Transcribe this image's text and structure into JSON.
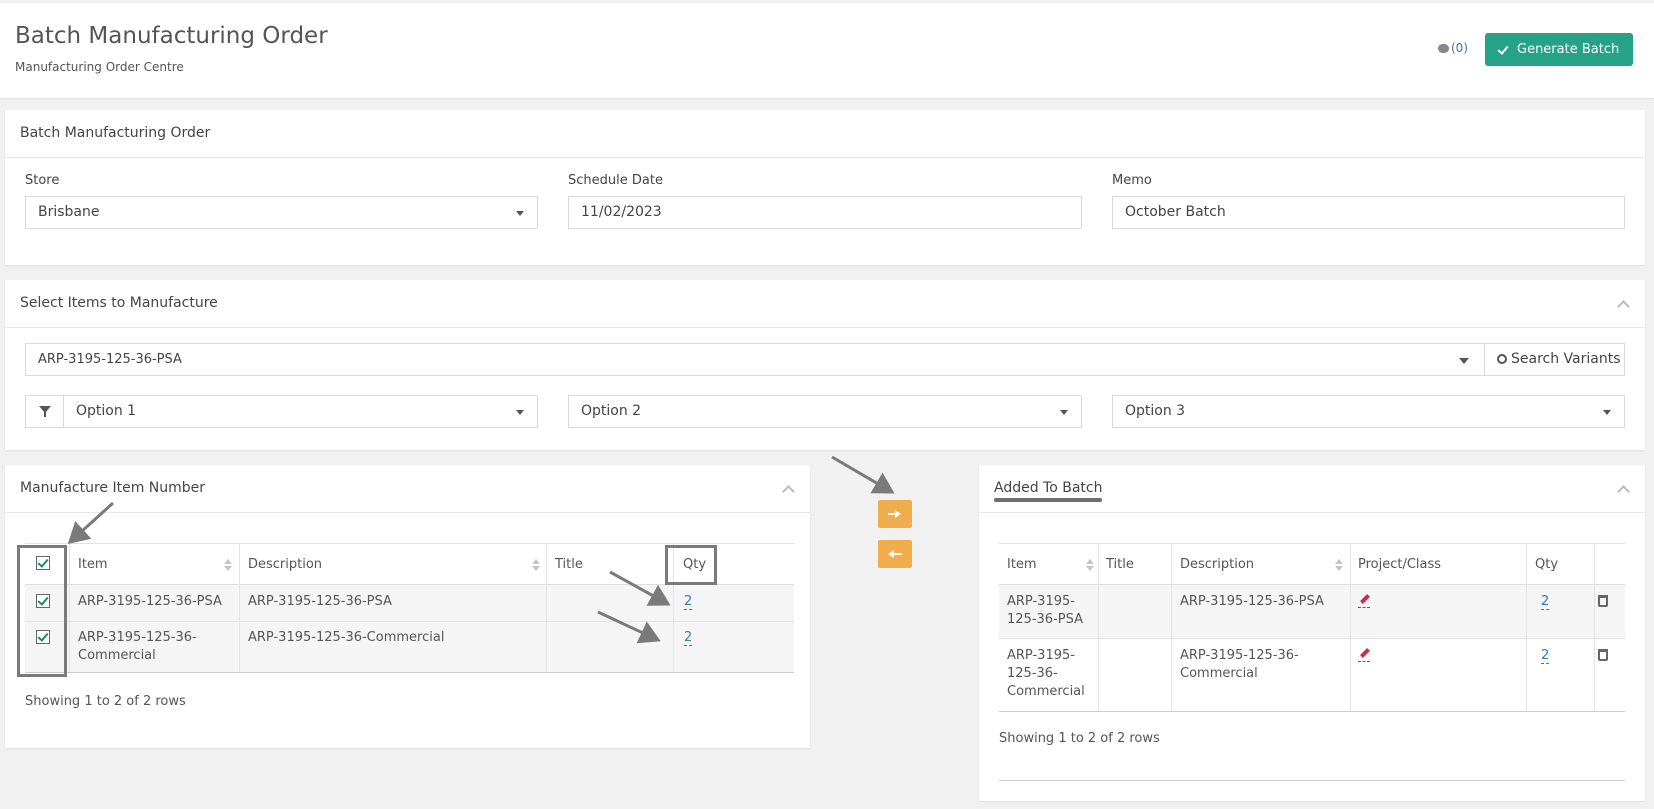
{
  "page": {
    "title": "Batch Manufacturing Order",
    "subtitle": "Manufacturing Order Centre",
    "comments_count": "(0)",
    "generate_button": "Generate Batch",
    "accent": "#26a386"
  },
  "order_panel": {
    "title": "Batch Manufacturing Order",
    "store_label": "Store",
    "store_value": "Brisbane",
    "date_label": "Schedule Date",
    "date_value": "11/02/2023",
    "memo_label": "Memo",
    "memo_value": "October Batch"
  },
  "select_panel": {
    "title": "Select Items to Manufacture",
    "item_value": "ARP-3195-125-36-PSA",
    "search_button": "Search Variants",
    "option1": "Option 1",
    "option2": "Option 2",
    "option3": "Option 3"
  },
  "left_table": {
    "title": "Manufacture Item Number",
    "columns": [
      "Item",
      "Description",
      "Title",
      "Qty"
    ],
    "rows": [
      {
        "item": "ARP-3195-125-36-PSA",
        "description": "ARP-3195-125-36-PSA",
        "title": "",
        "qty": "2",
        "checked": true
      },
      {
        "item": "ARP-3195-125-36-Commercial",
        "description": "ARP-3195-125-36-Commercial",
        "title": "",
        "qty": "2",
        "checked": true
      }
    ],
    "footer": "Showing 1 to 2 of 2 rows"
  },
  "right_table": {
    "title": "Added To Batch",
    "columns": [
      "Item",
      "Title",
      "Description",
      "Project/Class",
      "Qty"
    ],
    "rows": [
      {
        "item": "ARP-3195-125-36-PSA",
        "title": "",
        "description": "ARP-3195-125-36-PSA",
        "qty": "2"
      },
      {
        "item": "ARP-3195-125-36-Commercial",
        "title": "",
        "description": "ARP-3195-125-36-Commercial",
        "qty": "2"
      }
    ],
    "footer": "Showing 1 to 2 of 2 rows"
  }
}
